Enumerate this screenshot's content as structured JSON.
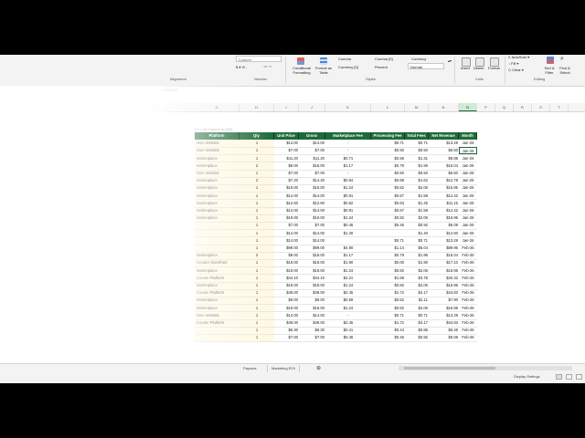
{
  "ribbon": {
    "number_format": "Custom",
    "styles": {
      "row1": [
        "Comma",
        "Comma [0]",
        "Currency"
      ],
      "row2": [
        "Currency [0]",
        "Percent",
        "Normal"
      ],
      "group_label": "Styles"
    },
    "conditional_formatting": "Conditional Formatting",
    "format_as_table": "Format as Table",
    "insert": "Insert",
    "delete": "Delete",
    "format": "Format",
    "cells_label": "Cells",
    "autosum": "AutoSum",
    "fill": "Fill",
    "clear": "Clear",
    "sort_filter": "Sort & Filter",
    "find_select": "Find & Select",
    "editing_label": "Editing",
    "alignment_label": "Alignment",
    "number_label": "Number"
  },
  "namebox": "A fx/E/9s D2",
  "columns": [
    "G",
    "H",
    "I",
    "J",
    "K",
    "L",
    "M",
    "N",
    "O",
    "P",
    "Q",
    "R",
    "S",
    "T"
  ],
  "selected_column": "O",
  "caption": "nd = All Figures in USD",
  "table": {
    "headers": [
      "Platform",
      "Qty",
      "Unit Price",
      "Gross",
      "Marketplace Fee",
      "Processing Fee",
      "Total Fees",
      "Net Revenue",
      "Month"
    ],
    "rows": [
      [
        "Own Website",
        "1",
        "$14.00",
        "$14.00",
        "-",
        "$0.71",
        "$0.71",
        "$13.29",
        "Jan-26"
      ],
      [
        "Own Website",
        "1",
        "$7.00",
        "$7.00",
        "-",
        "$0.50",
        "$0.50",
        "$6.50",
        "Jan-26"
      ],
      [
        "Marketplace",
        "1",
        "$11.20",
        "$11.20",
        "$0.71",
        "$0.59",
        "$1.31",
        "$9.89",
        "Jan-26"
      ],
      [
        "Marketplace",
        "2",
        "$9.00",
        "$18.00",
        "$1.17",
        "$0.79",
        "$1.96",
        "$16.04",
        "Jan-26"
      ],
      [
        "Own Website",
        "1",
        "$7.00",
        "$7.00",
        "-",
        "$0.50",
        "$0.50",
        "$6.50",
        "Jan-26"
      ],
      [
        "Marketplace",
        "2",
        "$7.20",
        "$14.40",
        "$0.94",
        "$0.68",
        "$1.62",
        "$12.78",
        "Jan-26"
      ],
      [
        "Marketplace",
        "1",
        "$19.00",
        "$19.00",
        "$1.24",
        "$0.82",
        "$2.06",
        "$16.95",
        "Jan-26"
      ],
      [
        "Marketplace",
        "1",
        "$14.00",
        "$14.00",
        "$0.91",
        "$0.67",
        "$1.58",
        "$12.42",
        "Jan-26"
      ],
      [
        "Marketplace",
        "1",
        "$12.60",
        "$12.60",
        "$0.82",
        "$0.63",
        "$1.45",
        "$11.15",
        "Jan-26"
      ],
      [
        "Marketplace",
        "1",
        "$14.00",
        "$14.00",
        "$0.91",
        "$0.67",
        "$1.58",
        "$12.42",
        "Jan-26"
      ],
      [
        "Marketplace",
        "1",
        "$19.00",
        "$19.00",
        "$1.24",
        "$0.82",
        "$2.06",
        "$16.95",
        "Jan-26"
      ],
      [
        "",
        "1",
        "$7.00",
        "$7.00",
        "$0.46",
        "$0.46",
        "$0.92",
        "$6.09",
        "Jan-26"
      ],
      [
        "",
        "1",
        "$14.00",
        "$14.00",
        "$1.40",
        "",
        "$1.40",
        "$12.60",
        "Jan-26"
      ],
      [
        "",
        "1",
        "$14.00",
        "$14.00",
        "",
        "$0.71",
        "$0.71",
        "$13.29",
        "Jan-26"
      ],
      [
        "",
        "1",
        "$99.00",
        "$99.00",
        "$4.90",
        "$1.14",
        "$6.04",
        "$89.96",
        "Feb-26"
      ],
      [
        "Marketplace",
        "2",
        "$9.00",
        "$18.00",
        "$1.17",
        "$0.79",
        "$1.96",
        "$16.04",
        "Feb-26"
      ],
      [
        "Creator Storefront",
        "1",
        "$19.00",
        "$19.00",
        "$1.90",
        "$0.00",
        "$1.90",
        "$17.10",
        "Feb-26"
      ],
      [
        "Marketplace",
        "1",
        "$19.00",
        "$19.00",
        "$1.24",
        "$0.82",
        "$2.06",
        "$16.95",
        "Feb-26"
      ],
      [
        "Course Platform",
        "1",
        "$44.10",
        "$44.10",
        "$2.21",
        "$1.58",
        "$3.78",
        "$40.32",
        "Feb-26"
      ],
      [
        "Marketplace",
        "1",
        "$19.00",
        "$19.00",
        "$1.24",
        "$0.82",
        "$2.06",
        "$16.95",
        "Feb-26"
      ],
      [
        "Course Platform",
        "1",
        "$49.00",
        "$49.00",
        "$2.45",
        "$1.72",
        "$4.17",
        "$44.83",
        "Feb-26"
      ],
      [
        "Marketplace",
        "1",
        "$9.00",
        "$9.00",
        "$0.59",
        "$0.52",
        "$1.11",
        "$7.90",
        "Feb-26"
      ],
      [
        "Marketplace",
        "1",
        "$19.00",
        "$19.00",
        "$1.24",
        "$0.82",
        "$2.06",
        "$16.95",
        "Feb-26"
      ],
      [
        "Own Website",
        "1",
        "$14.00",
        "$14.00",
        "-",
        "$0.71",
        "$0.71",
        "$13.29",
        "Feb-26"
      ],
      [
        "Course Platform",
        "1",
        "$49.00",
        "$49.00",
        "$2.45",
        "$1.72",
        "$4.17",
        "$44.83",
        "Feb-26"
      ],
      [
        "",
        "1",
        "$6.30",
        "$6.30",
        "$0.41",
        "$0.44",
        "$0.85",
        "$5.45",
        "Feb-26"
      ],
      [
        "",
        "1",
        "$7.00",
        "$7.00",
        "$0.46",
        "$0.46",
        "$0.92",
        "$6.08",
        "Feb-26"
      ]
    ]
  },
  "selected_cell_value": "Jan-26",
  "sheet_tabs": [
    "Payouts",
    "Marketing ROI"
  ],
  "status": {
    "display_settings": "Display Settings"
  },
  "colors": {
    "header_green": "#1e6b3a",
    "selection_green": "#1d6b38"
  }
}
